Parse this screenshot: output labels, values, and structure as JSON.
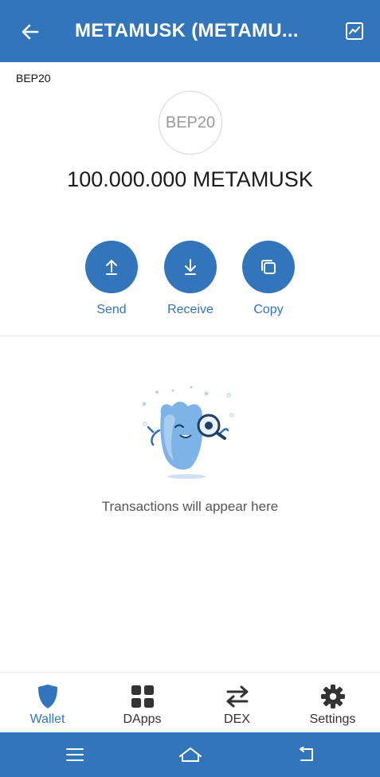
{
  "header": {
    "title": "METAMUSK (METAMU...",
    "back_icon": "arrow-left-icon",
    "chart_icon": "chart-line-icon",
    "background": "#3375bb"
  },
  "token": {
    "network": "BEP20",
    "logo_text": "BEP20",
    "balance": "100.000.000 METAMUSK"
  },
  "actions": [
    {
      "label": "Send",
      "icon": "arrow-up-icon"
    },
    {
      "label": "Receive",
      "icon": "arrow-down-icon"
    },
    {
      "label": "Copy",
      "icon": "copy-icon"
    }
  ],
  "empty_state": {
    "message": "Transactions will appear here",
    "icon": "mascot-magnifier-icon"
  },
  "tabbar": {
    "items": [
      {
        "label": "Wallet",
        "icon": "shield-icon",
        "active": true
      },
      {
        "label": "DApps",
        "icon": "grid-icon",
        "active": false
      },
      {
        "label": "DEX",
        "icon": "swap-arrows-icon",
        "active": false
      },
      {
        "label": "Settings",
        "icon": "gear-icon",
        "active": false
      }
    ],
    "active_color": "#3375bb"
  },
  "system_nav": {
    "icons": [
      "menu-icon",
      "home-icon",
      "back-icon"
    ]
  }
}
